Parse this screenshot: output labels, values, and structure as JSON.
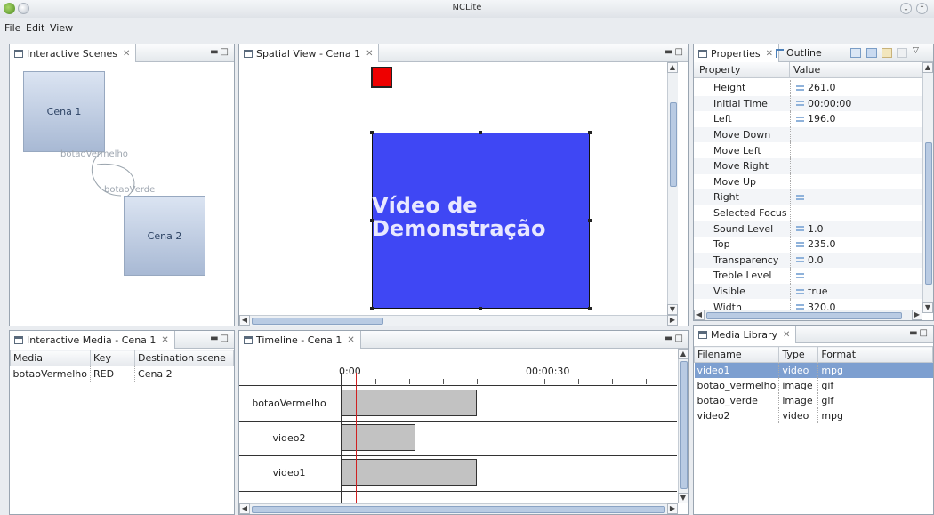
{
  "window": {
    "title": "NCLite"
  },
  "menu": [
    "File",
    "Edit",
    "View"
  ],
  "interactive_scenes": {
    "tab": "Interactive Scenes",
    "scenes": [
      "Cena 1",
      "Cena 2"
    ],
    "links": [
      "botaoVermelho",
      "botaoVerde"
    ]
  },
  "spatial_view": {
    "tab": "Spatial View - Cena 1",
    "video_text_line1": "Vídeo de",
    "video_text_line2": "Demonstração",
    "colors": {
      "red_button": "#ee0000",
      "video_region": "#3f47f4"
    }
  },
  "properties": {
    "tab": "Properties",
    "outline_tab": "Outline",
    "columns": [
      "Property",
      "Value"
    ],
    "rows": [
      {
        "name": "Height",
        "value": "261.0"
      },
      {
        "name": "Initial Time",
        "value": "00:00:00"
      },
      {
        "name": "Left",
        "value": "196.0"
      },
      {
        "name": "Move Down",
        "value": ""
      },
      {
        "name": "Move Left",
        "value": ""
      },
      {
        "name": "Move Right",
        "value": ""
      },
      {
        "name": "Move Up",
        "value": ""
      },
      {
        "name": "Right",
        "value": ""
      },
      {
        "name": "Selected Focus M",
        "value": ""
      },
      {
        "name": "Sound Level",
        "value": "1.0"
      },
      {
        "name": "Top",
        "value": "235.0"
      },
      {
        "name": "Transparency",
        "value": "0.0"
      },
      {
        "name": "Treble Level",
        "value": ""
      },
      {
        "name": "Visible",
        "value": "true"
      },
      {
        "name": "Width",
        "value": "320.0"
      }
    ]
  },
  "interactive_media": {
    "tab": "Interactive Media - Cena 1",
    "columns": [
      "Media",
      "Key",
      "Destination scene"
    ],
    "rows": [
      {
        "media": "botaoVermelho",
        "key": "RED",
        "dest": "Cena 2"
      }
    ]
  },
  "timeline": {
    "tab": "Timeline - Cena 1",
    "ticks": [
      "0:00",
      "00:00:30"
    ],
    "rows": [
      "botaoVermelho",
      "video2",
      "video1"
    ]
  },
  "media_library": {
    "tab": "Media Library",
    "columns": [
      "Filename",
      "Type",
      "Format"
    ],
    "rows": [
      {
        "filename": "video1",
        "type": "video",
        "format": "mpg"
      },
      {
        "filename": "botao_vermelho",
        "type": "image",
        "format": "gif"
      },
      {
        "filename": "botao_verde",
        "type": "image",
        "format": "gif"
      },
      {
        "filename": "video2",
        "type": "video",
        "format": "mpg"
      }
    ]
  }
}
